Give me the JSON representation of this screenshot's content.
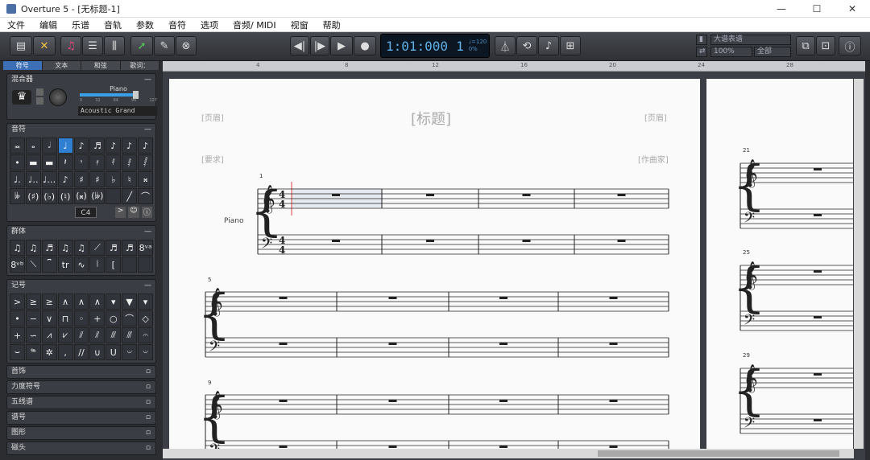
{
  "window": {
    "title": "Overture 5 - [无标题-1]",
    "minimize": "—",
    "maximize": "☐",
    "close": "✕"
  },
  "menu": [
    "文件",
    "编辑",
    "乐谱",
    "音轨",
    "参数",
    "音符",
    "选项",
    "音频/ MIDI",
    "视窗",
    "帮助"
  ],
  "transport": {
    "time": "1:01:000",
    "beat": "1",
    "tempo_label": "♩=120",
    "percent": "0%"
  },
  "toolbar": {
    "staff_select": "大谱表谱",
    "zoom": "100%",
    "view": "全部"
  },
  "leftpanel": {
    "tabs": [
      "符号",
      "文本",
      "和弦",
      "歌词："
    ],
    "mixer": {
      "title": "混合器",
      "instrument": "Piano",
      "patch": "Acoustic Grand",
      "scale": [
        "0",
        "32",
        "64",
        "96",
        "127"
      ]
    },
    "notes": {
      "title": "音符",
      "pitch": "C4"
    },
    "groups": {
      "title": "群体"
    },
    "marks": {
      "title": "记号"
    },
    "collapsed": [
      "首饰",
      "力度符号",
      "五线谱",
      "谱号",
      "图形",
      "磁头"
    ]
  },
  "score": {
    "ruler": [
      "4",
      "8",
      "12",
      "16",
      "20",
      "24",
      "28"
    ],
    "header_left": "[页眉]",
    "header_right": "[页眉]",
    "title": "[标题]",
    "instructions": "[要求]",
    "composer": "[作曲家]",
    "instrument": "Piano",
    "measure_numbers": [
      "1",
      "5",
      "9"
    ],
    "page2_measures": [
      "21",
      "25",
      "29"
    ],
    "time_sig": "4"
  }
}
